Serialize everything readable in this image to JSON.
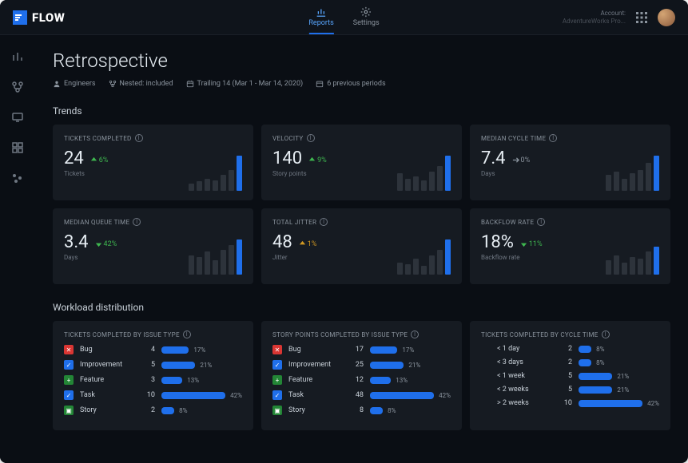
{
  "brand": "FLOW",
  "topnav": {
    "reports": "Reports",
    "settings": "Settings"
  },
  "account": {
    "label": "Account:",
    "name": "AdventureWorks Pro..."
  },
  "page": {
    "title": "Retrospective",
    "filters": {
      "team": "Engineers",
      "nested": "Nested: included",
      "range": "Trailing 14 (Mar 1 - Mar 14, 2020)",
      "periods": "6 previous periods"
    }
  },
  "sections": {
    "trends": "Trends",
    "workload": "Workload distribution"
  },
  "trend_cards": [
    {
      "title": "TICKETS COMPLETED",
      "value": "24",
      "delta": "6%",
      "dir": "up",
      "sub": "Tickets",
      "bars": [
        20,
        28,
        35,
        30,
        45,
        60,
        100
      ]
    },
    {
      "title": "VELOCITY",
      "value": "140",
      "delta": "9%",
      "dir": "up",
      "sub": "Story points",
      "bars": [
        50,
        35,
        40,
        30,
        55,
        70,
        100
      ]
    },
    {
      "title": "MEDIAN CYCLE TIME",
      "value": "7.4",
      "delta": "0%",
      "dir": "flat",
      "sub": "Days",
      "bars": [
        45,
        55,
        35,
        50,
        60,
        80,
        100
      ]
    },
    {
      "title": "MEDIAN QUEUE TIME",
      "value": "3.4",
      "delta": "42%",
      "dir": "down",
      "sub": "Days",
      "bars": [
        55,
        50,
        65,
        40,
        70,
        85,
        100
      ]
    },
    {
      "title": "TOTAL JITTER",
      "value": "48",
      "delta": "1%",
      "dir": "warn",
      "sub": "Jitter",
      "bars": [
        35,
        30,
        45,
        25,
        55,
        70,
        100
      ]
    },
    {
      "title": "BACKFLOW RATE",
      "value": "18%",
      "delta": "11%",
      "dir": "down",
      "sub": "Backflow rate",
      "bars": [
        40,
        55,
        35,
        50,
        45,
        65,
        80
      ]
    }
  ],
  "dist_cards": [
    {
      "title": "TICKETS COMPLETED BY ISSUE TYPE",
      "rows": [
        {
          "icon": "bug",
          "label": "Bug",
          "count": "4",
          "pct": 17
        },
        {
          "icon": "improvement",
          "label": "Improvement",
          "count": "5",
          "pct": 21
        },
        {
          "icon": "feature",
          "label": "Feature",
          "count": "3",
          "pct": 13
        },
        {
          "icon": "task",
          "label": "Task",
          "count": "10",
          "pct": 42
        },
        {
          "icon": "story",
          "label": "Story",
          "count": "2",
          "pct": 8
        }
      ]
    },
    {
      "title": "STORY POINTS COMPLETED BY ISSUE TYPE",
      "rows": [
        {
          "icon": "bug",
          "label": "Bug",
          "count": "17",
          "pct": 17
        },
        {
          "icon": "improvement",
          "label": "Improvement",
          "count": "25",
          "pct": 21
        },
        {
          "icon": "feature",
          "label": "Feature",
          "count": "12",
          "pct": 13
        },
        {
          "icon": "task",
          "label": "Task",
          "count": "48",
          "pct": 42
        },
        {
          "icon": "story",
          "label": "Story",
          "count": "8",
          "pct": 8
        }
      ]
    },
    {
      "title": "TICKETS COMPLETED BY CYCLE TIME",
      "rows": [
        {
          "icon": "",
          "label": "< 1 day",
          "count": "2",
          "pct": 8
        },
        {
          "icon": "",
          "label": "< 3 days",
          "count": "2",
          "pct": 8
        },
        {
          "icon": "",
          "label": "< 1 week",
          "count": "5",
          "pct": 21
        },
        {
          "icon": "",
          "label": "< 2 weeks",
          "count": "5",
          "pct": 21
        },
        {
          "icon": "",
          "label": "> 2 weeks",
          "count": "10",
          "pct": 42
        }
      ]
    }
  ],
  "chart_data": {
    "type": "bar",
    "note": "sparkline bars per metric card, relative heights (0-100)",
    "series": [
      {
        "name": "Tickets completed",
        "values": [
          20,
          28,
          35,
          30,
          45,
          60,
          100
        ]
      },
      {
        "name": "Velocity",
        "values": [
          50,
          35,
          40,
          30,
          55,
          70,
          100
        ]
      },
      {
        "name": "Median cycle time",
        "values": [
          45,
          55,
          35,
          50,
          60,
          80,
          100
        ]
      },
      {
        "name": "Median queue time",
        "values": [
          55,
          50,
          65,
          40,
          70,
          85,
          100
        ]
      },
      {
        "name": "Total jitter",
        "values": [
          35,
          30,
          45,
          25,
          55,
          70,
          100
        ]
      },
      {
        "name": "Backflow rate",
        "values": [
          40,
          55,
          35,
          50,
          45,
          65,
          80
        ]
      }
    ]
  }
}
